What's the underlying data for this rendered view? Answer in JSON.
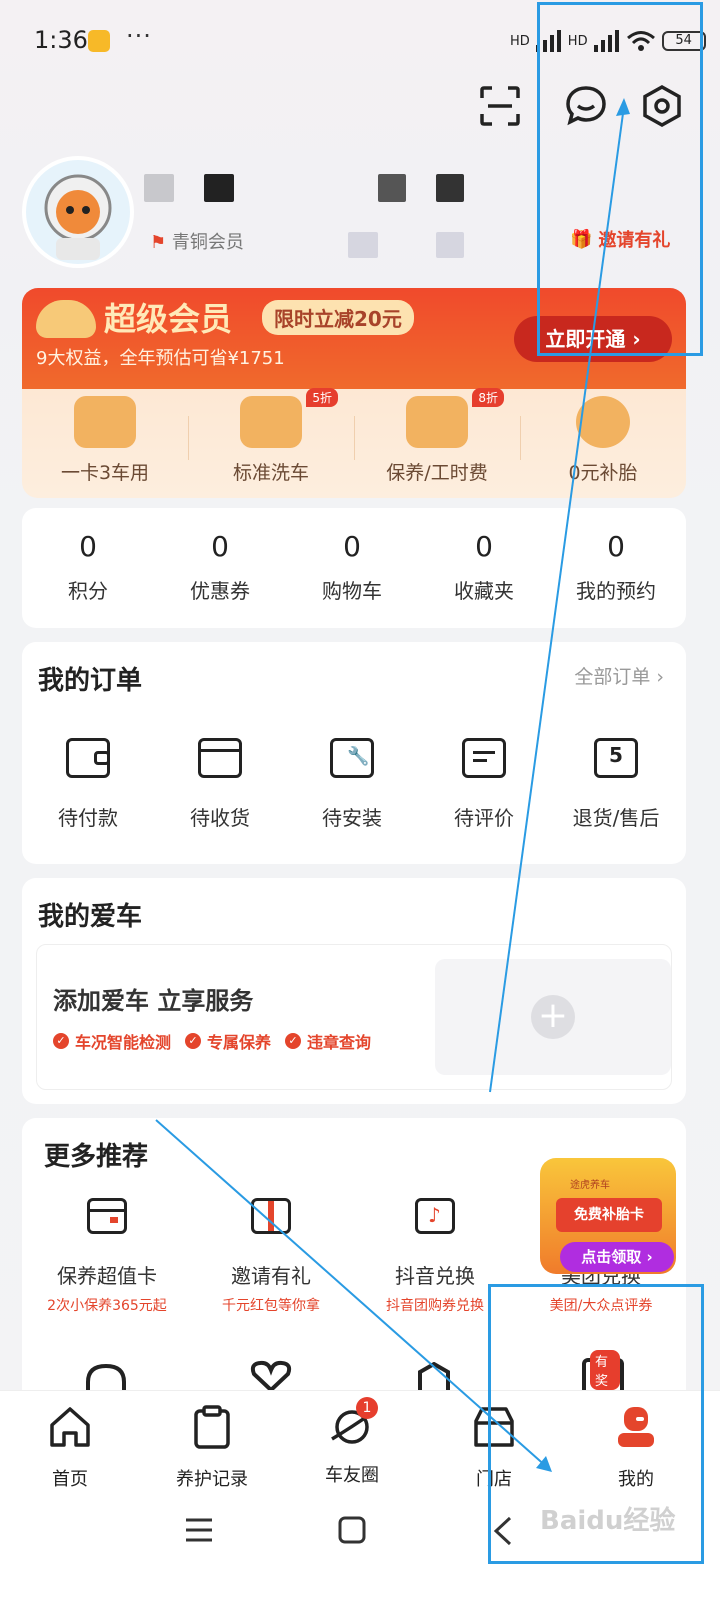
{
  "status_bar": {
    "time": "1:36",
    "dots": "···",
    "network_1": "HD",
    "network_2": "HD",
    "battery": "54"
  },
  "profile": {
    "member_text": "青铜会员",
    "invite_label": "邀请有礼"
  },
  "banner": {
    "title": "超级会员",
    "promo": "限时立减20元",
    "subtitle": "9大权益，全年预估可省¥1751",
    "cta": "立即开通 ›",
    "perks": [
      {
        "label": "一卡3车用",
        "badge": ""
      },
      {
        "label": "标准洗车",
        "badge": "5折"
      },
      {
        "label": "保养/工时费",
        "badge": "8折"
      },
      {
        "label": "0元补胎",
        "badge": ""
      }
    ]
  },
  "stats": [
    {
      "value": "0",
      "label": "积分"
    },
    {
      "value": "0",
      "label": "优惠券"
    },
    {
      "value": "0",
      "label": "购物车"
    },
    {
      "value": "0",
      "label": "收藏夹"
    },
    {
      "value": "0",
      "label": "我的预约"
    }
  ],
  "orders": {
    "title": "我的订单",
    "all_link": "全部订单 ›",
    "items": [
      {
        "label": "待付款",
        "icon": "wallet-icon"
      },
      {
        "label": "待收货",
        "icon": "box-icon"
      },
      {
        "label": "待安装",
        "icon": "wrench-icon"
      },
      {
        "label": "待评价",
        "icon": "comment-icon"
      },
      {
        "label": "退货/售后",
        "icon": "return-icon"
      }
    ]
  },
  "car": {
    "title": "我的爱车",
    "add_title": "添加爱车 立享服务",
    "tags": [
      "车况智能检测",
      "专属保养",
      "违章查询"
    ]
  },
  "recommend": {
    "title": "更多推荐",
    "items": [
      {
        "label": "保养超值卡",
        "sub": "2次小保养365元起",
        "icon": "card-icon"
      },
      {
        "label": "邀请有礼",
        "sub": "千元红包等你拿",
        "icon": "gift-icon"
      },
      {
        "label": "抖音兑换",
        "sub": "抖音团购券兑换",
        "icon": "douyin-ticket-icon"
      },
      {
        "label": "美团兑换",
        "sub": "美团/大众点评券",
        "icon": "meituan-ticket-icon"
      }
    ],
    "promo_card": {
      "brand": "途虎养车",
      "inner": "免费补胎卡",
      "button": "点击领取 ›"
    },
    "row2_badge": "有奖"
  },
  "tabbar": {
    "tabs": [
      {
        "label": "首页",
        "icon": "home-icon"
      },
      {
        "label": "养护记录",
        "icon": "clipboard-icon"
      },
      {
        "label": "车友圈",
        "icon": "planet-icon",
        "badge": "1"
      },
      {
        "label": "门店",
        "icon": "store-icon"
      },
      {
        "label": "我的",
        "icon": "profile-icon"
      }
    ]
  },
  "watermark": "Baidu经验",
  "colors": {
    "accent": "#e4452c",
    "annotation": "#2a9be3",
    "banner_red": "#f04a2c"
  }
}
